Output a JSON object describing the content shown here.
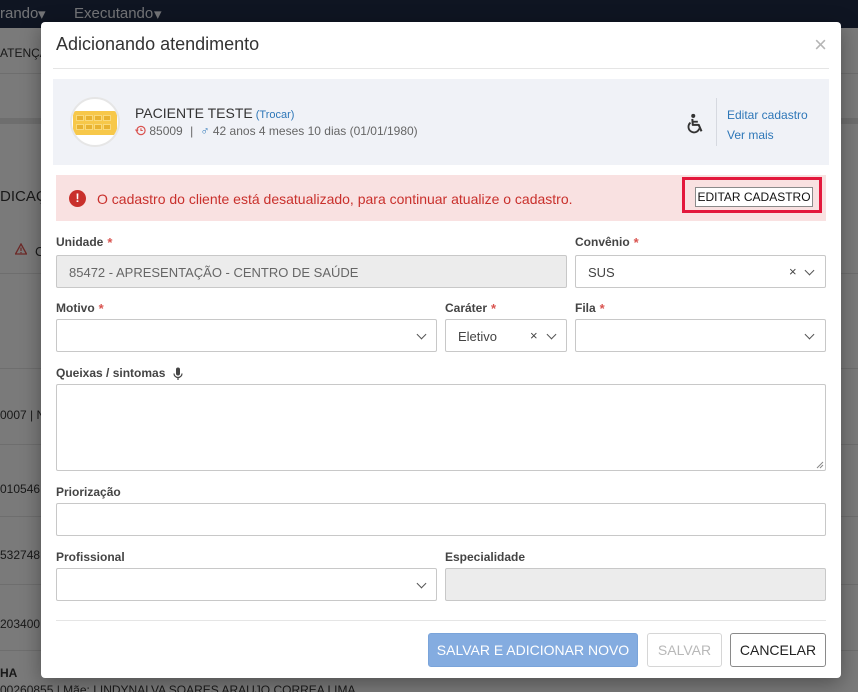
{
  "background": {
    "topbar": {
      "left_fragment": "rando",
      "nav_executando": "Executando"
    },
    "fragments": {
      "atencao": "ATENÇÃ",
      "indicacao": "DICAÇ",
      "warn_fragment": "C",
      "row1": "0007 | N",
      "row2": "010546",
      "row3": "532748",
      "row4": "203400",
      "row5_name": "HA",
      "row5_code": "00260855 | Mãe: LINDYNALVA SOARES ARAUJO CORREA LIMA"
    }
  },
  "modal": {
    "title": "Adicionando atendimento",
    "close": "×",
    "patient": {
      "name": "PACIENTE TESTE",
      "swap_link": "(Trocar)",
      "code": "85009",
      "separator": "|",
      "age": "42 anos 4 meses 10 dias (01/01/1980)",
      "edit_link": "Editar cadastro",
      "more_link": "Ver mais"
    },
    "alert": {
      "icon": "!",
      "message": "O cadastro do cliente está desatualizado, para continuar atualize o cadastro.",
      "button": "EDITAR CADASTRO",
      "highlight_color": "#e3183c"
    },
    "form": {
      "unidade": {
        "label": "Unidade",
        "required_mark": "*",
        "value": "85472 - APRESENTAÇÃO - CENTRO DE SAÚDE"
      },
      "convenio": {
        "label": "Convênio",
        "required_mark": "*",
        "value": "SUS",
        "clear": "×"
      },
      "motivo": {
        "label": "Motivo",
        "required_mark": "*",
        "value": ""
      },
      "carater": {
        "label": "Caráter",
        "required_mark": "*",
        "value": "Eletivo",
        "clear": "×"
      },
      "fila": {
        "label": "Fila",
        "required_mark": "*",
        "value": ""
      },
      "queixas": {
        "label": "Queixas / sintomas"
      },
      "priorizacao": {
        "label": "Priorização",
        "value": ""
      },
      "profissional": {
        "label": "Profissional",
        "value": ""
      },
      "especialidade": {
        "label": "Especialidade",
        "value": ""
      }
    },
    "buttons": {
      "save_new": "SALVAR E ADICIONAR NOVO",
      "save": "SALVAR",
      "cancel": "CANCELAR"
    }
  },
  "colors": {
    "primary_button": "#84ace0",
    "alert_background": "#f9e1e1",
    "alert_text": "#c9302c",
    "link": "#2e77b8",
    "topbar": "#1e2a44"
  }
}
